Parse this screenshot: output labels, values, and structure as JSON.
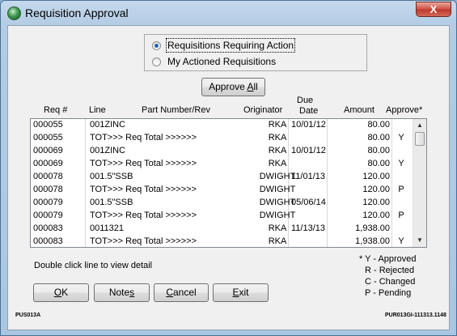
{
  "window": {
    "title": "Requisition Approval",
    "close_label": "X"
  },
  "radios": [
    {
      "label": "Requisitions Requiring Action",
      "checked": true
    },
    {
      "label": "My Actioned Requisitions",
      "checked": false
    }
  ],
  "approve_all": {
    "pre": "Approve ",
    "u": "A",
    "post": "ll"
  },
  "columns": {
    "req": "Req #",
    "line": "Line",
    "part": "Part Number/Rev",
    "orig": "Originator",
    "due1": "Due",
    "due2": "Date",
    "amount": "Amount",
    "approve": "Approve*"
  },
  "rows": [
    {
      "req": "000055",
      "line": " 001ZINC",
      "orig": "RKA",
      "due": "10/01/12",
      "amount": "80.00",
      "appr": ""
    },
    {
      "req": "000055",
      "line": "TOT>>> Req Total >>>>>>",
      "orig": "RKA",
      "due": "",
      "amount": "80.00",
      "appr": "Y"
    },
    {
      "req": "000069",
      "line": " 001ZINC",
      "orig": "RKA",
      "due": "10/01/12",
      "amount": "80.00",
      "appr": ""
    },
    {
      "req": "000069",
      "line": "TOT>>> Req Total >>>>>>",
      "orig": "RKA",
      "due": "",
      "amount": "80.00",
      "appr": "Y"
    },
    {
      "req": "000078",
      "line": " 001.5\"SSB",
      "orig": "DWIGHT",
      "due": "11/01/13",
      "amount": "120.00",
      "appr": ""
    },
    {
      "req": "000078",
      "line": "TOT>>> Req Total >>>>>>",
      "orig": "DWIGHT",
      "due": "",
      "amount": "120.00",
      "appr": "P"
    },
    {
      "req": "000079",
      "line": " 001.5\"SSB",
      "orig": "DWIGHT",
      "due": "05/06/14",
      "amount": "120.00",
      "appr": ""
    },
    {
      "req": "000079",
      "line": "TOT>>> Req Total >>>>>>",
      "orig": "DWIGHT",
      "due": "",
      "amount": "120.00",
      "appr": "P"
    },
    {
      "req": "000083",
      "line": " 0011321",
      "orig": "RKA",
      "due": "11/13/13",
      "amount": "1,938.00",
      "appr": ""
    },
    {
      "req": "000083",
      "line": "TOT>>> Req Total >>>>>>",
      "orig": "RKA",
      "due": "",
      "amount": "1,938.00",
      "appr": "Y"
    }
  ],
  "scrollbar": {
    "up_icon": "▲",
    "down_icon": "▼"
  },
  "hint": "Double click line to view detail",
  "legend": [
    "* Y - Approved",
    "R - Rejected",
    "C - Changed",
    "P - Pending"
  ],
  "buttons": {
    "ok": {
      "u": "O",
      "post": "K"
    },
    "notes": {
      "pre": "Note",
      "u": "s",
      "post": ""
    },
    "cancel": {
      "pre": "",
      "u": "C",
      "post": "ancel"
    },
    "exit": {
      "pre": "",
      "u": "E",
      "post": "xit"
    }
  },
  "footer": {
    "left": "PUS013A",
    "right": "PUR013GI-111313.1148"
  }
}
